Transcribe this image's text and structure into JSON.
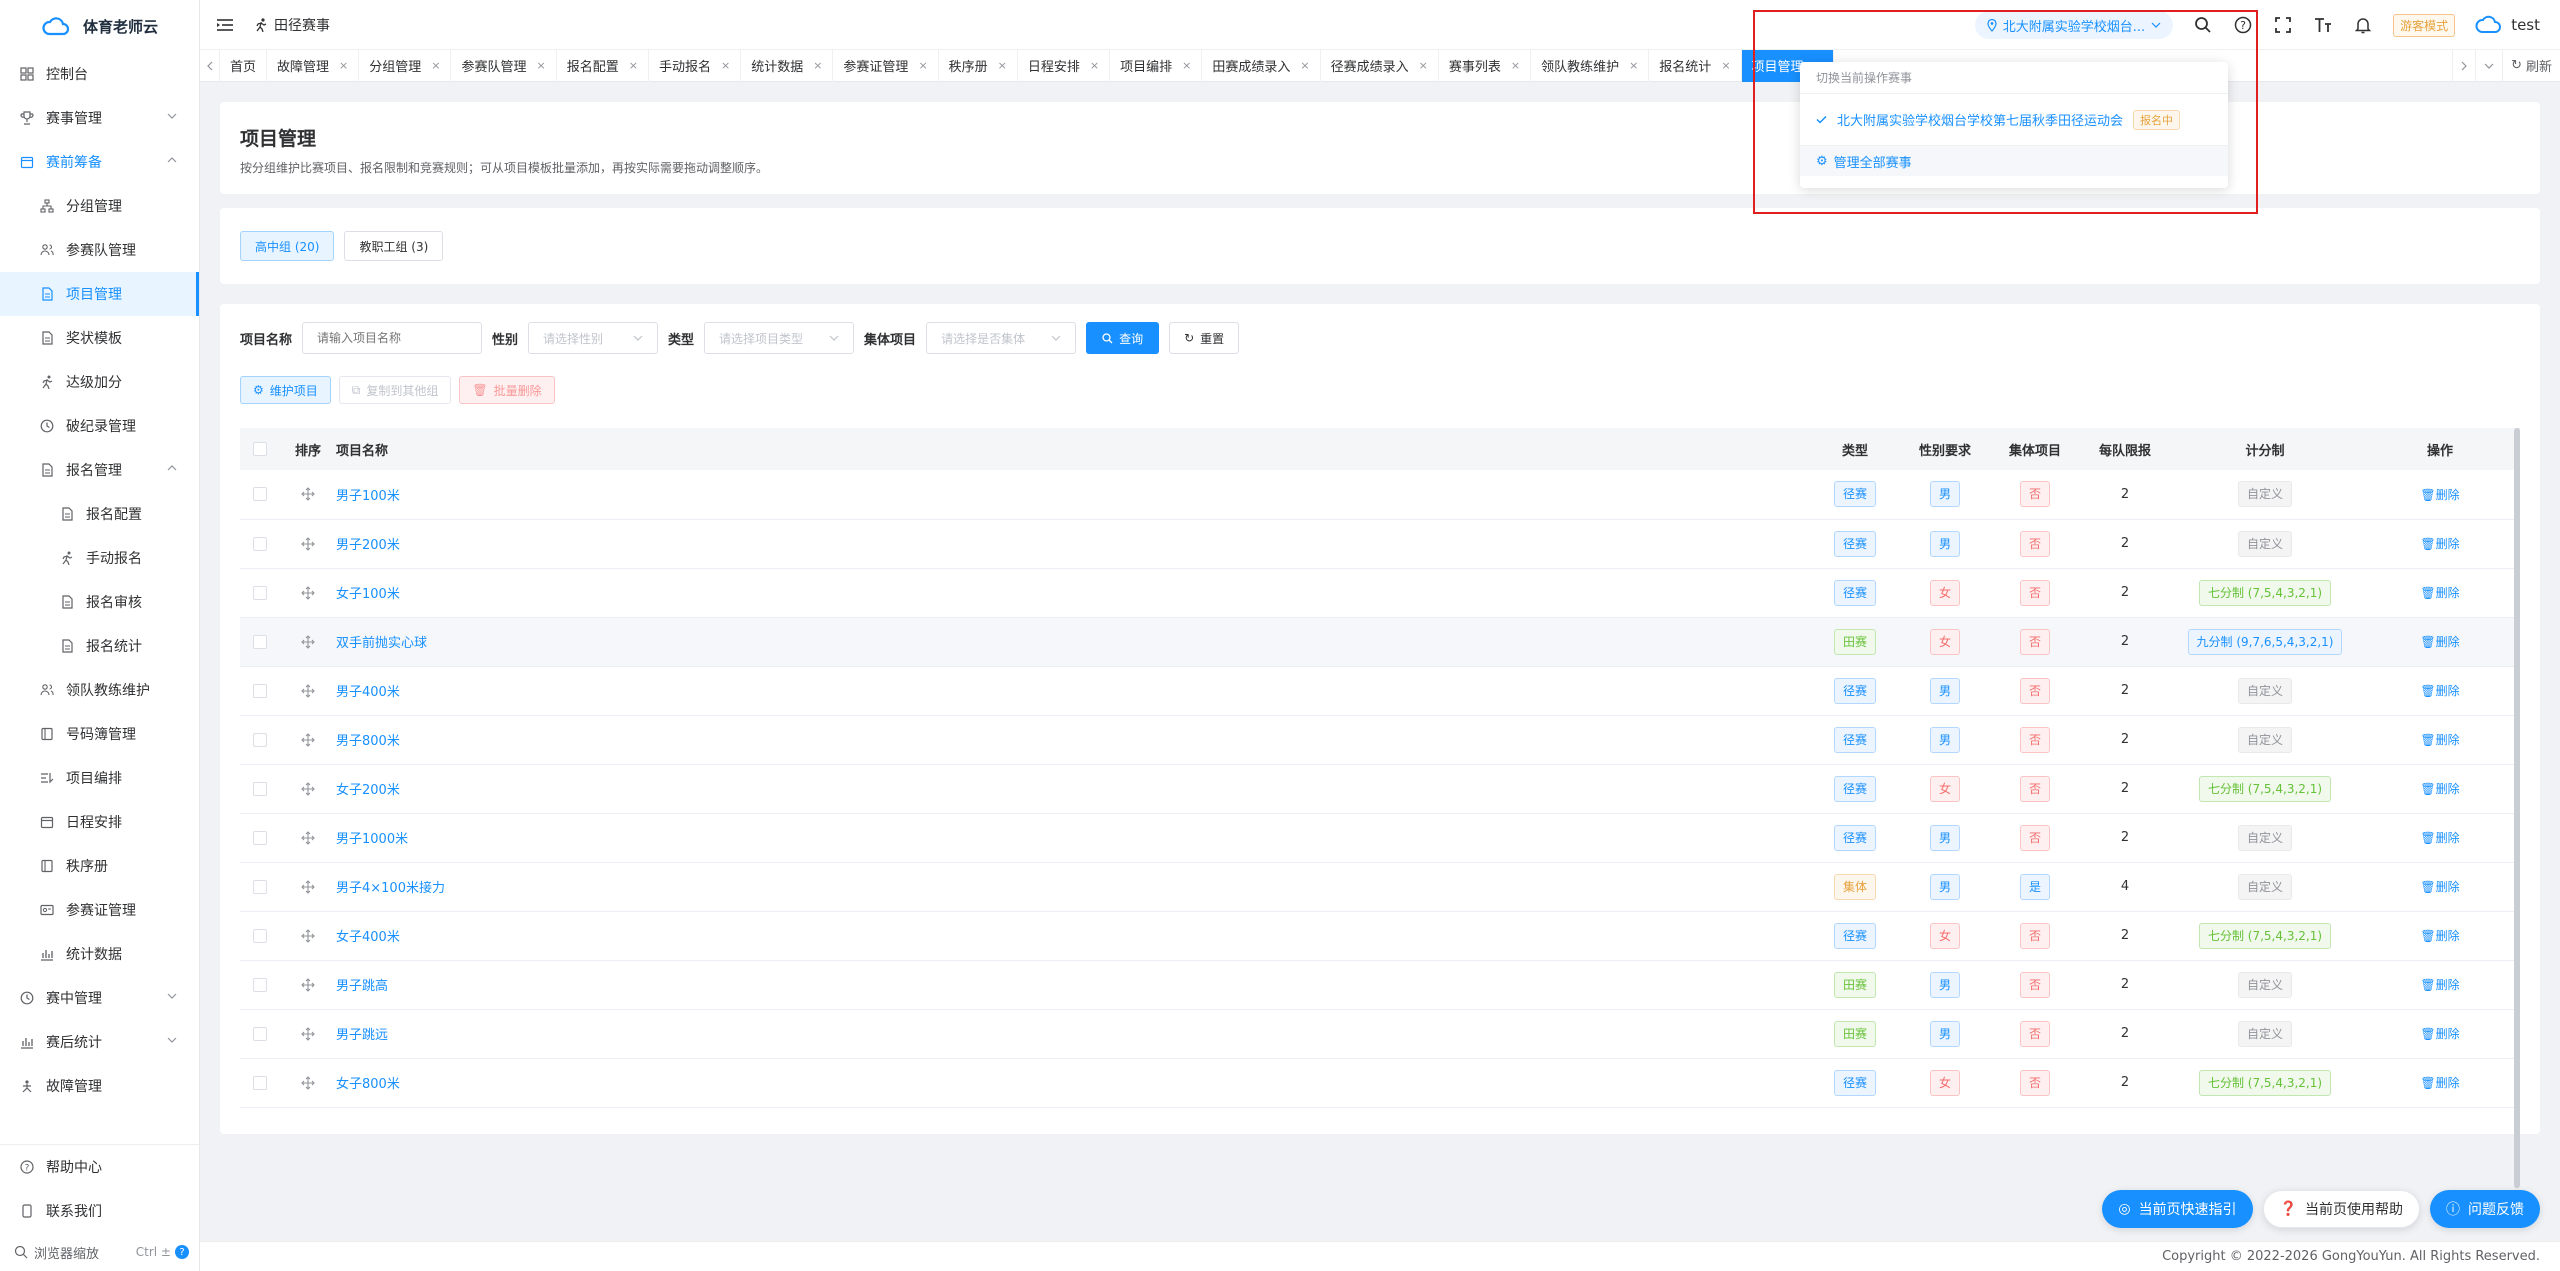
{
  "app": {
    "name": "体育老师云"
  },
  "sidebar": {
    "items": [
      {
        "label": "控制台"
      },
      {
        "label": "赛事管理"
      },
      {
        "label": "赛前筹备"
      },
      {
        "label": "分组管理"
      },
      {
        "label": "参赛队管理"
      },
      {
        "label": "项目管理"
      },
      {
        "label": "奖状模板"
      },
      {
        "label": "达级加分"
      },
      {
        "label": "破纪录管理"
      },
      {
        "label": "报名管理"
      },
      {
        "label": "报名配置"
      },
      {
        "label": "手动报名"
      },
      {
        "label": "报名审核"
      },
      {
        "label": "报名统计"
      },
      {
        "label": "领队教练维护"
      },
      {
        "label": "号码簿管理"
      },
      {
        "label": "项目编排"
      },
      {
        "label": "日程安排"
      },
      {
        "label": "秩序册"
      },
      {
        "label": "参赛证管理"
      },
      {
        "label": "统计数据"
      },
      {
        "label": "赛中管理"
      },
      {
        "label": "赛后统计"
      },
      {
        "label": "故障管理"
      }
    ],
    "bottom": {
      "help": "帮助中心",
      "contact": "联系我们",
      "zoom": "浏览器缩放",
      "zoom_key": "Ctrl ±",
      "zoom_q": "?"
    }
  },
  "navbar": {
    "crumb": "田径赛事",
    "competition": "北大附属实验学校烟台...",
    "guest_mode": "游客模式",
    "user": "test"
  },
  "tags": [
    {
      "label": "首页"
    },
    {
      "label": "故障管理"
    },
    {
      "label": "分组管理"
    },
    {
      "label": "参赛队管理"
    },
    {
      "label": "报名配置"
    },
    {
      "label": "手动报名"
    },
    {
      "label": "统计数据"
    },
    {
      "label": "参赛证管理"
    },
    {
      "label": "秩序册"
    },
    {
      "label": "日程安排"
    },
    {
      "label": "项目编排"
    },
    {
      "label": "田赛成绩录入"
    },
    {
      "label": "径赛成绩录入"
    },
    {
      "label": "赛事列表"
    },
    {
      "label": "领队教练维护"
    },
    {
      "label": "报名统计"
    },
    {
      "label": "项目管理"
    }
  ],
  "tags_refresh": "刷新",
  "page": {
    "title": "项目管理",
    "desc": "按分组维护比赛项目、报名限制和竞赛规则；可从项目模板批量添加，再按实际需要拖动调整顺序。"
  },
  "groups": [
    "高中组 (20)",
    "教职工组 (3)"
  ],
  "filters": {
    "name_label": "项目名称",
    "name_ph": "请输入项目名称",
    "gender_label": "性别",
    "gender_ph": "请选择性别",
    "type_label": "类型",
    "type_ph": "请选择项目类型",
    "team_label": "集体项目",
    "team_ph": "请选择是否集体",
    "query": "查询",
    "reset": "重置"
  },
  "actions": {
    "maintain": "维护项目",
    "copy": "复制到其他组",
    "batch_delete": "批量删除"
  },
  "table": {
    "headers": {
      "sort": "排序",
      "name": "项目名称",
      "type": "类型",
      "gender": "性别要求",
      "team": "集体项目",
      "limit": "每队限报",
      "scoring": "计分制",
      "op": "操作"
    },
    "delete_label": "删除",
    "rows": [
      {
        "name": "男子100米",
        "type": "径赛",
        "gender": "男",
        "team": "否",
        "limit": "2",
        "scoring": "自定义"
      },
      {
        "name": "男子200米",
        "type": "径赛",
        "gender": "男",
        "team": "否",
        "limit": "2",
        "scoring": "自定义"
      },
      {
        "name": "女子100米",
        "type": "径赛",
        "gender": "女",
        "team": "否",
        "limit": "2",
        "scoring": "七分制 (7,5,4,3,2,1)"
      },
      {
        "name": "双手前抛实心球",
        "type": "田赛",
        "gender": "女",
        "team": "否",
        "limit": "2",
        "scoring": "九分制 (9,7,6,5,4,3,2,1)"
      },
      {
        "name": "男子400米",
        "type": "径赛",
        "gender": "男",
        "team": "否",
        "limit": "2",
        "scoring": "自定义"
      },
      {
        "name": "男子800米",
        "type": "径赛",
        "gender": "男",
        "team": "否",
        "limit": "2",
        "scoring": "自定义"
      },
      {
        "name": "女子200米",
        "type": "径赛",
        "gender": "女",
        "team": "否",
        "limit": "2",
        "scoring": "七分制 (7,5,4,3,2,1)"
      },
      {
        "name": "男子1000米",
        "type": "径赛",
        "gender": "男",
        "team": "否",
        "limit": "2",
        "scoring": "自定义"
      },
      {
        "name": "男子4×100米接力",
        "type": "集体",
        "gender": "男",
        "team": "是",
        "limit": "4",
        "scoring": "自定义"
      },
      {
        "name": "女子400米",
        "type": "径赛",
        "gender": "女",
        "team": "否",
        "limit": "2",
        "scoring": "七分制 (7,5,4,3,2,1)"
      },
      {
        "name": "男子跳高",
        "type": "田赛",
        "gender": "男",
        "team": "否",
        "limit": "2",
        "scoring": "自定义"
      },
      {
        "name": "男子跳远",
        "type": "田赛",
        "gender": "男",
        "team": "否",
        "limit": "2",
        "scoring": "自定义"
      },
      {
        "name": "女子800米",
        "type": "径赛",
        "gender": "女",
        "team": "否",
        "limit": "2",
        "scoring": "七分制 (7,5,4,3,2,1)"
      }
    ]
  },
  "dropdown": {
    "title": "切换当前操作赛事",
    "item": "北大附属实验学校烟台学校第七届秋季田径运动会",
    "badge": "报名中",
    "manage": "管理全部赛事"
  },
  "float": {
    "guide": "当前页快速指引",
    "help": "当前页使用帮助",
    "feedback": "问题反馈"
  },
  "footer": "Copyright © 2022-2026 GongYouYun. All Rights Reserved.",
  "colors": {
    "primary": "#1890ff",
    "highlight_border": "#e02020"
  }
}
